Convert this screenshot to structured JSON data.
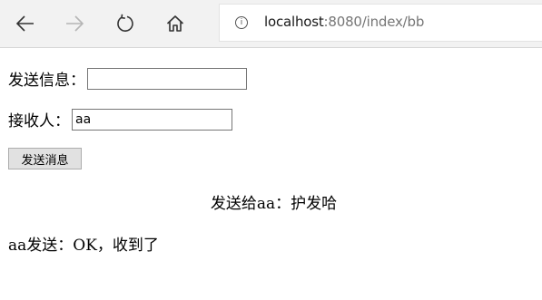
{
  "browser": {
    "back_icon": "arrow-left-icon",
    "forward_icon": "arrow-right-icon",
    "refresh_icon": "refresh-icon",
    "home_icon": "home-icon",
    "address": {
      "host": "localhost",
      "rest": ":8080/index/bb"
    }
  },
  "form": {
    "message_label": "发送信息：",
    "message_value": "",
    "recipient_label": "接收人：",
    "recipient_value": "aa",
    "send_button_label": "发送消息"
  },
  "log": {
    "sent": "发送给aa：护发哈",
    "received": "aa发送：OK，收到了"
  }
}
